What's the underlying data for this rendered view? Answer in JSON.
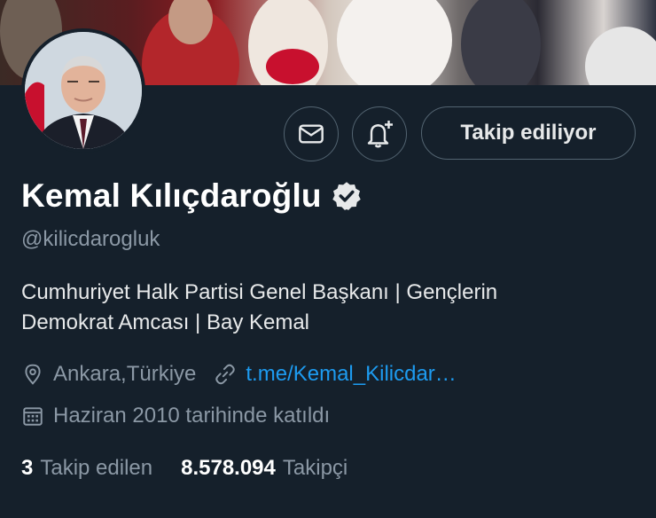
{
  "profile": {
    "follow_label": "Takip ediliyor",
    "name": "Kemal Kılıçdaroğlu",
    "handle": "@kilicdarogluk",
    "bio_line1": "Cumhuriyet Halk Partisi Genel Başkanı | Gençlerin",
    "bio_line2": "Demokrat Amcası | Bay Kemal",
    "location": "Ankara,Türkiye",
    "link": "t.me/Kemal_Kilicdar…",
    "joined": "Haziran 2010 tarihinde katıldı",
    "following_count": "3",
    "following_label": "Takip edilen",
    "followers_count": "8.578.094",
    "followers_label": "Takipçi"
  },
  "icons": [
    "message-icon",
    "notification-bell-add-icon",
    "verified-badge-icon",
    "location-pin-icon",
    "link-icon",
    "calendar-icon"
  ],
  "colors": {
    "background": "#15202b",
    "link": "#1d9bf0",
    "secondary_text": "#8b98a5",
    "verified": "#e7e9ea"
  }
}
